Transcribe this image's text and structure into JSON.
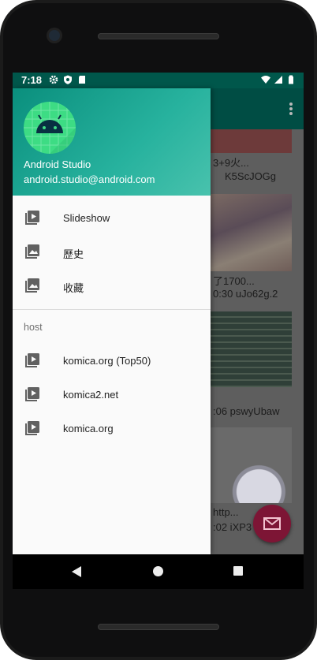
{
  "status_bar": {
    "time": "7:18"
  },
  "background_content": {
    "card_texts": [
      {
        "title": "3+9火...",
        "meta": "K5ScJOGg"
      },
      {
        "title": "了1700...",
        "meta": "0:30  uJo62g.2"
      },
      {
        "title": "",
        "meta": ":06  pswyUbaw"
      },
      {
        "title": "http...",
        "meta": ":02  iXP3"
      }
    ]
  },
  "drawer": {
    "header": {
      "name": "Android Studio",
      "email": "android.studio@android.com"
    },
    "items": [
      {
        "label": "Slideshow",
        "icon": "slideshow-icon"
      },
      {
        "label": "歷史",
        "icon": "gallery-icon"
      },
      {
        "label": "收藏",
        "icon": "gallery-icon"
      }
    ],
    "section_title": "host",
    "host_items": [
      {
        "label": "komica.org (Top50)",
        "icon": "slideshow-icon"
      },
      {
        "label": "komica2.net",
        "icon": "slideshow-icon"
      },
      {
        "label": "komica.org",
        "icon": "slideshow-icon"
      }
    ]
  },
  "colors": {
    "status_bar": "#00574b",
    "app_bar": "#004d44",
    "drawer_header_start": "#0a8f7d",
    "drawer_header_end": "#49c2ad",
    "fab": "#7d1535"
  }
}
